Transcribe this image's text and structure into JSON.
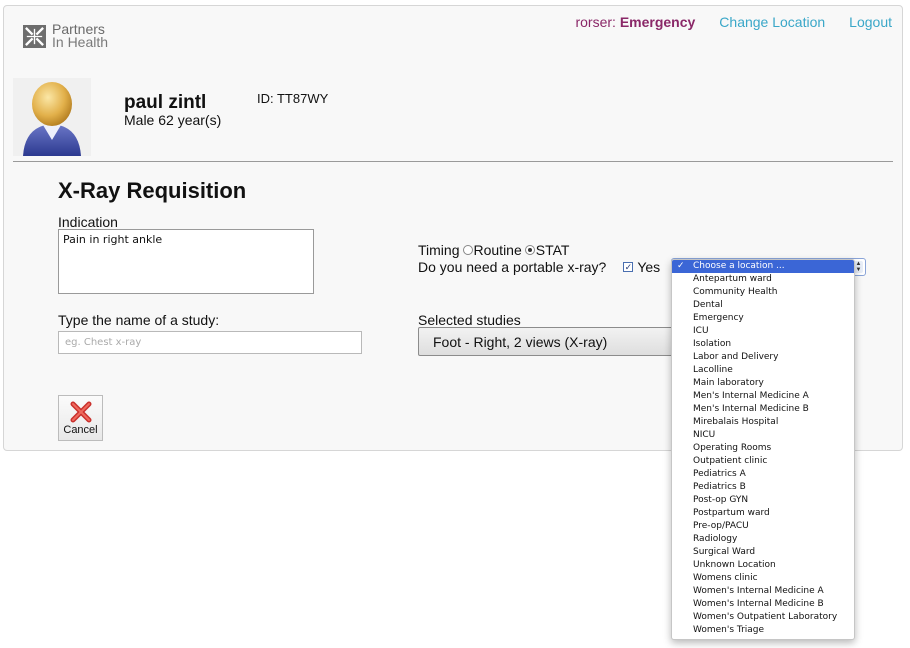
{
  "header": {
    "logo_line1": "Partners",
    "logo_line2": "In Health",
    "username": "rorser:",
    "location": "Emergency",
    "change_location": "Change Location",
    "logout": "Logout"
  },
  "patient": {
    "name": "paul zintl",
    "info": "Male 62 year(s)",
    "id": "ID: TT87WY"
  },
  "form": {
    "title": "X-Ray Requisition",
    "indication_label": "Indication",
    "indication_value": "Pain in right ankle",
    "study_label": "Type the name of a study:",
    "study_placeholder": "eg. Chest x-ray",
    "timing_label": "Timing",
    "timing_routine": "Routine",
    "timing_stat": "STAT",
    "timing_selected": "STAT",
    "portable_label": "Do you need a portable x-ray?",
    "portable_yes": "Yes",
    "portable_checked": true,
    "selected_label": "Selected studies",
    "selected_study": "Foot - Right, 2 views (X-ray)",
    "cancel_label": "Cancel"
  },
  "location_select": {
    "selected": "Choose a location ...",
    "options": [
      "Choose a location ...",
      "Antepartum ward",
      "Community Health",
      "Dental",
      "Emergency",
      "ICU",
      "Isolation",
      "Labor and Delivery",
      "Lacolline",
      "Main laboratory",
      "Men's Internal Medicine A",
      "Men's Internal Medicine B",
      "Mirebalais Hospital",
      "NICU",
      "Operating Rooms",
      "Outpatient clinic",
      "Pediatrics A",
      "Pediatrics B",
      "Post-op GYN",
      "Postpartum ward",
      "Pre-op/PACU",
      "Radiology",
      "Surgical Ward",
      "Unknown Location",
      "Womens clinic",
      "Women's Internal Medicine A",
      "Women's Internal Medicine B",
      "Women's Outpatient Laboratory",
      "Women's Triage"
    ]
  },
  "colors": {
    "accent_purple": "#8a2868",
    "link_blue": "#3aa7c8",
    "select_highlight": "#3b66d6"
  }
}
